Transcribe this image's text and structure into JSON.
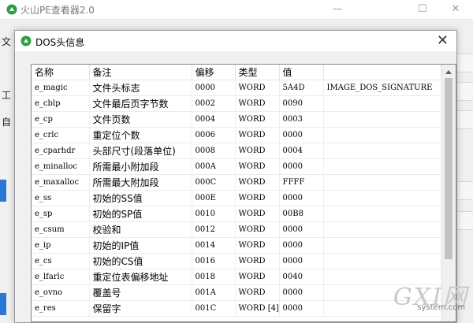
{
  "app": {
    "title": "火山PE查看器2.0",
    "icon": "leaf-icon",
    "minimize_glyph": "—",
    "maximize_glyph": "☐",
    "close_glyph": "✕"
  },
  "background": {
    "labels": [
      "文",
      "工",
      "自"
    ]
  },
  "dialog": {
    "title": "DOS头信息",
    "icon": "leaf-icon",
    "close_glyph": "✕"
  },
  "table": {
    "columns": [
      "名称",
      "备注",
      "偏移",
      "类型",
      "值",
      ""
    ],
    "rows": [
      {
        "name": "e_magic",
        "note": "文件头标志",
        "offset": "0000",
        "type": "WORD",
        "value": "5A4D",
        "extra": "IMAGE_DOS_SIGNATURE"
      },
      {
        "name": "e_cblp",
        "note": "文件最后页字节数",
        "offset": "0002",
        "type": "WORD",
        "value": "0090",
        "extra": ""
      },
      {
        "name": "e_cp",
        "note": "文件页数",
        "offset": "0004",
        "type": "WORD",
        "value": "0003",
        "extra": ""
      },
      {
        "name": "e_crlc",
        "note": "重定位个数",
        "offset": "0006",
        "type": "WORD",
        "value": "0000",
        "extra": ""
      },
      {
        "name": "e_cparhdr",
        "note": "头部尺寸(段落单位)",
        "offset": "0008",
        "type": "WORD",
        "value": "0004",
        "extra": ""
      },
      {
        "name": "e_minalloc",
        "note": "所需最小附加段",
        "offset": "000A",
        "type": "WORD",
        "value": "0000",
        "extra": ""
      },
      {
        "name": "e_maxalloc",
        "note": "所需最大附加段",
        "offset": "000C",
        "type": "WORD",
        "value": "FFFF",
        "extra": ""
      },
      {
        "name": "e_ss",
        "note": "初始的SS值",
        "offset": "000E",
        "type": "WORD",
        "value": "0000",
        "extra": ""
      },
      {
        "name": "e_sp",
        "note": "初始的SP值",
        "offset": "0010",
        "type": "WORD",
        "value": "00B8",
        "extra": ""
      },
      {
        "name": "e_csum",
        "note": "校验和",
        "offset": "0012",
        "type": "WORD",
        "value": "0000",
        "extra": ""
      },
      {
        "name": "e_ip",
        "note": "初始的IP值",
        "offset": "0014",
        "type": "WORD",
        "value": "0000",
        "extra": ""
      },
      {
        "name": "e_cs",
        "note": "初始的CS值",
        "offset": "0016",
        "type": "WORD",
        "value": "0000",
        "extra": ""
      },
      {
        "name": "e_lfarlc",
        "note": "重定位表偏移地址",
        "offset": "0018",
        "type": "WORD",
        "value": "0040",
        "extra": ""
      },
      {
        "name": "e_ovno",
        "note": "覆盖号",
        "offset": "001A",
        "type": "WORD",
        "value": "0000",
        "extra": ""
      },
      {
        "name": "e_res",
        "note": "保留字",
        "offset": "001C",
        "type": "WORD [4]",
        "value": "0000",
        "extra": ""
      }
    ]
  },
  "watermark": {
    "logo": "GXI网",
    "site": "system.com"
  },
  "colors": {
    "accent_blue": "#2b78d4",
    "icon_green": "#2e9e44"
  }
}
